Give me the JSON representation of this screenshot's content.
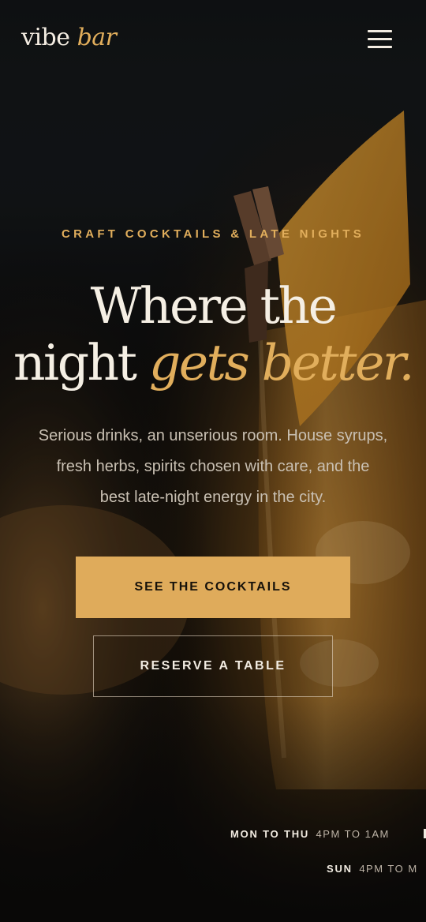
{
  "header": {
    "logo_main": "vibe",
    "logo_accent": "bar"
  },
  "hero": {
    "eyebrow": "CRAFT COCKTAILS & LATE NIGHTS",
    "headline_line1": "Where the",
    "headline_line2_plain": "night",
    "headline_line2_accent": "gets better.",
    "subtext_line1": "Serious drinks, an unserious room. House syrups,",
    "subtext_line2": "fresh herbs, spirits chosen with care, and the",
    "subtext_line3": "best late-night energy in the city.",
    "primary_cta": "SEE THE COCKTAILS",
    "secondary_cta": "RESERVE A TABLE"
  },
  "hours": [
    {
      "days": "MON TO THU",
      "time": "4PM TO 1AM"
    },
    {
      "days": "SUN",
      "time": "4PM TO M"
    }
  ],
  "colors": {
    "accent": "#e1ae5c",
    "background": "#0b0a09",
    "text": "#f5efe4"
  },
  "icons": {
    "menu": "hamburger-icon"
  }
}
